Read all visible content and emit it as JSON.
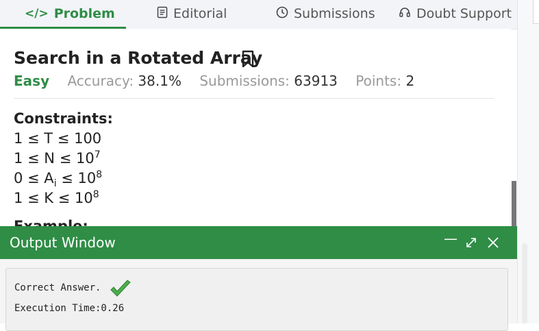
{
  "tabs": [
    {
      "label": "Problem",
      "icon": "code-icon",
      "active": true
    },
    {
      "label": "Editorial",
      "icon": "document-icon",
      "active": false
    },
    {
      "label": "Submissions",
      "icon": "clock-icon",
      "active": false
    },
    {
      "label": "Doubt Support",
      "icon": "headset-icon",
      "active": false
    }
  ],
  "problem": {
    "title": "Search in a Rotated Array",
    "difficulty": "Easy",
    "accuracy_label": "Accuracy:",
    "accuracy_value": "38.1%",
    "submissions_label": "Submissions:",
    "submissions_value": "63913",
    "points_label": "Points:",
    "points_value": "2",
    "constraints_heading": "Constraints:",
    "constraints": [
      {
        "pre": "1 ≤ T ≤ 100",
        "sub": "",
        "mid": "",
        "sup": ""
      },
      {
        "pre": "1 ≤ N ≤ 10",
        "sub": "",
        "mid": "",
        "sup": "7"
      },
      {
        "pre": "0 ≤ A",
        "sub": "i",
        "mid": " ≤ 10",
        "sup": "8"
      },
      {
        "pre": "1 ≤ K ≤ 10",
        "sub": "",
        "mid": "",
        "sup": "8"
      }
    ],
    "example_heading": "Example:"
  },
  "output_window": {
    "title": "Output Window",
    "line1": "Correct Answer.",
    "line2": "Execution Time:0.26"
  },
  "colors": {
    "accent": "#2f8d46"
  }
}
